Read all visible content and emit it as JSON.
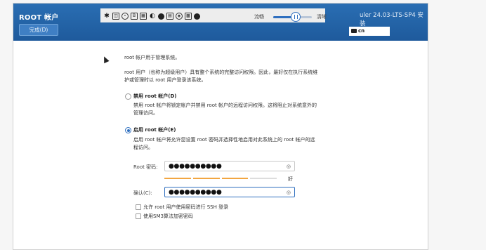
{
  "header": {
    "title": "ROOT 帐户",
    "done_label": "完成(D)",
    "flow_label": "流畅",
    "clear_label": "清晰",
    "product": "uler 24.03-LTS-SP4 安装",
    "keyboard_layout": "cn",
    "slider_fraction": 0.6
  },
  "content": {
    "intro": "root 帐户用于管理系统。",
    "desc_line1": "root 用户（也称为超级用户）具有整个系统的完整访问权限。因此，最好仅在执行系统维",
    "desc_line2": "护或管理时以 root 用户登录该系统。",
    "disable_label": "禁用 root 帐户(D)",
    "disable_desc1": "禁用 root 帐户将锁定帐户并禁用 root 帐户的远程访问权限。这将阻止对系统意外的",
    "disable_desc2": "管理访问。",
    "enable_label": "启用 root 帐户(E)",
    "enable_desc1": "启用 root 帐户将允许您设置 root 密码并选择性地启用对此系统上的 root 帐户的远",
    "enable_desc2": "程访问。",
    "password_label": "Root 密码:",
    "password_value": "●●●●●●●●●●",
    "strength_label": "好",
    "confirm_label": "确认(C):",
    "confirm_value": "●●●●●●●●●●",
    "ssh_label": "允许 root 用户使用密码进行 SSH 登录",
    "sm3_label": "使用SM3算法加密密码",
    "selected_option": "enable"
  }
}
